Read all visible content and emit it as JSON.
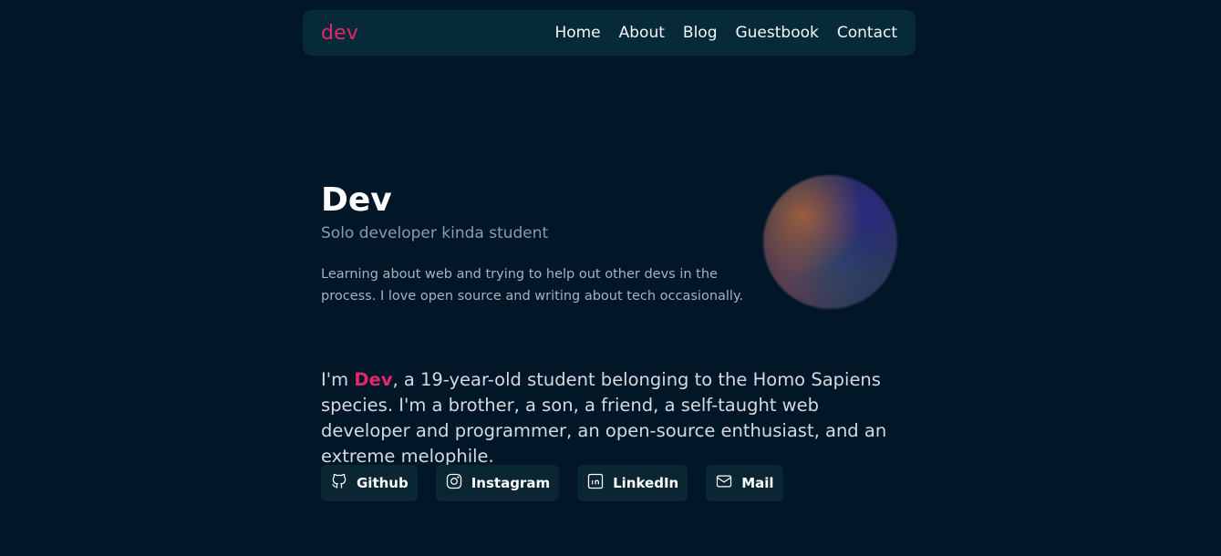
{
  "nav": {
    "logo": "dev",
    "links": [
      "Home",
      "About",
      "Blog",
      "Guestbook",
      "Contact"
    ]
  },
  "hero": {
    "name": "Dev",
    "subtitle": "Solo developer kinda student",
    "description": "Learning about web and trying to help out other devs in the process. I love open source and writing about tech occasionally."
  },
  "bio": {
    "prefix": "I'm ",
    "highlight": "Dev",
    "rest": ", a 19-year-old student belonging to the Homo Sapiens species. I'm a brother, a son, a friend, a self-taught web developer and programmer, an open-source enthusiast, and an extreme melophile."
  },
  "socials": [
    {
      "label": "Github",
      "icon": "github-icon"
    },
    {
      "label": "Instagram",
      "icon": "instagram-icon"
    },
    {
      "label": "LinkedIn",
      "icon": "linkedin-icon"
    },
    {
      "label": "Mail",
      "icon": "mail-icon"
    }
  ],
  "colors": {
    "background": "#011627",
    "navbar": "#072a38",
    "accent": "#e0286e",
    "button": "#0b2633"
  }
}
